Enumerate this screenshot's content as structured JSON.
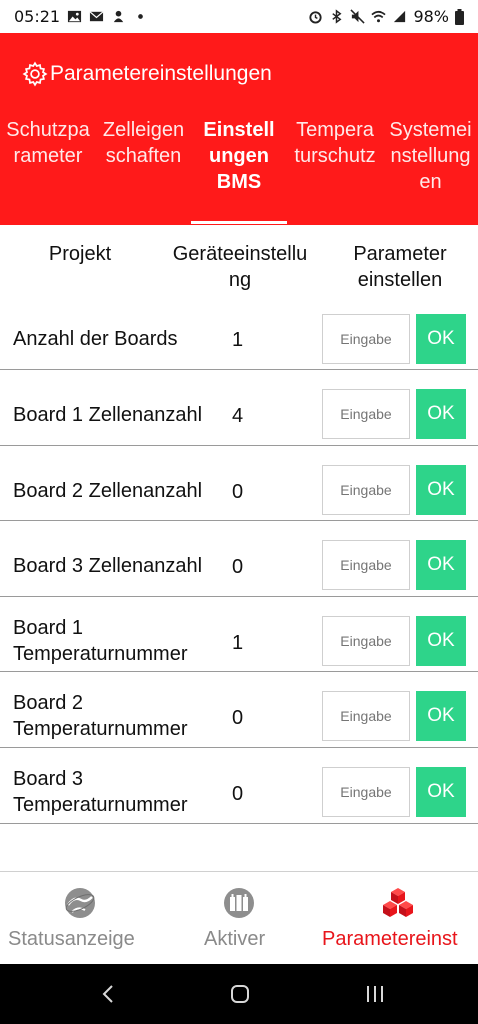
{
  "status_bar": {
    "time": "05:21",
    "battery": "98%"
  },
  "header": {
    "title": "Parametereinstellungen"
  },
  "tabs": [
    {
      "line1": "Schutzpa",
      "line2": "rameter",
      "line3": ""
    },
    {
      "line1": "Zelleigen",
      "line2": "schaften",
      "line3": ""
    },
    {
      "line1": "Einstell",
      "line2": "ungen",
      "line3": "BMS"
    },
    {
      "line1": "Tempera",
      "line2": "turschutz",
      "line3": ""
    },
    {
      "line1": "Systemei",
      "line2": "nstellung",
      "line3": "en"
    }
  ],
  "columns": {
    "project": "Projekt",
    "device_line1": "Geräteeinstellu",
    "device_line2": "ng",
    "param_line1": "Parameter",
    "param_line2": "einstellen"
  },
  "rows": [
    {
      "name_line1": "Anzahl der Boards",
      "name_line2": "",
      "value": "1",
      "placeholder": "Eingabe",
      "ok": "OK"
    },
    {
      "name_line1": "Board 1 Zellenanzahl",
      "name_line2": "",
      "value": "4",
      "placeholder": "Eingabe",
      "ok": "OK"
    },
    {
      "name_line1": "Board 2 Zellenanzahl",
      "name_line2": "",
      "value": "0",
      "placeholder": "Eingabe",
      "ok": "OK"
    },
    {
      "name_line1": "Board 3 Zellenanzahl",
      "name_line2": "",
      "value": "0",
      "placeholder": "Eingabe",
      "ok": "OK"
    },
    {
      "name_line1": "Board 1",
      "name_line2": "Temperaturnummer",
      "value": "1",
      "placeholder": "Eingabe",
      "ok": "OK"
    },
    {
      "name_line1": "Board 2",
      "name_line2": "Temperaturnummer",
      "value": "0",
      "placeholder": "Eingabe",
      "ok": "OK"
    },
    {
      "name_line1": "Board 3",
      "name_line2": "Temperaturnummer",
      "value": "0",
      "placeholder": "Eingabe",
      "ok": "OK"
    }
  ],
  "bottom_nav": [
    {
      "label": "Statusanzeige",
      "icon": "globe-icon",
      "active": false
    },
    {
      "label": "Aktiver",
      "icon": "balancer-icon",
      "active": false
    },
    {
      "label": "Parametereinst",
      "icon": "cubes-icon",
      "active": true
    }
  ],
  "colors": {
    "header": "#ff1a1a",
    "ok_button": "#2ed48a",
    "active_nav": "#e8151b",
    "inactive_nav": "#8a8a8a"
  }
}
